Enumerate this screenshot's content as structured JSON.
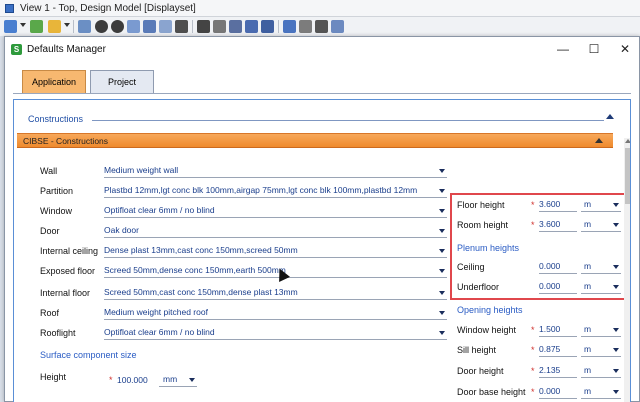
{
  "app": {
    "title": "View 1 - Top, Design Model [Displayset]"
  },
  "dialog": {
    "title": "Defaults Manager",
    "controls": {
      "minimize": "—",
      "maximize": "☐",
      "close": "✕"
    },
    "tabs": [
      {
        "label": "Application",
        "active": true
      },
      {
        "label": "Project",
        "active": false
      }
    ]
  },
  "content": {
    "section_title": "Constructions",
    "group_title": "CIBSE - Constructions",
    "rows": [
      {
        "label": "Wall",
        "value": "Medium weight wall"
      },
      {
        "label": "Partition",
        "value": "Plastbd 12mm,lgt conc blk 100mm,airgap 75mm,lgt conc blk 100mm,plastbd 12mm"
      },
      {
        "label": "Window",
        "value": "Optifloat clear 6mm / no blind"
      },
      {
        "label": "Door",
        "value": "Oak door"
      },
      {
        "label": "Internal ceiling",
        "value": "Dense plast 13mm,cast conc 150mm,screed 50mm"
      },
      {
        "label": "Exposed floor",
        "value": "Screed 50mm,dense conc 150mm,earth 500mm"
      },
      {
        "label": "Internal floor",
        "value": "Screed 50mm,cast conc 150mm,dense plast 13mm"
      },
      {
        "label": "Roof",
        "value": "Medium weight pitched roof"
      },
      {
        "label": "Rooflight",
        "value": "Optifloat clear 6mm / no blind"
      }
    ],
    "surface_heading": "Surface component size",
    "height": {
      "label": "Height",
      "star": "*",
      "value": "100.000",
      "unit": "mm"
    },
    "right": {
      "floor_height": {
        "label": "Floor height",
        "star": "*",
        "value": "3.600",
        "unit": "m"
      },
      "room_height": {
        "label": "Room height",
        "star": "*",
        "value": "3.600",
        "unit": "m"
      },
      "plenum_heading": "Plenum heights",
      "ceiling": {
        "label": "Ceiling",
        "value": "0.000",
        "unit": "m"
      },
      "underfloor": {
        "label": "Underfloor",
        "value": "0.000",
        "unit": "m"
      },
      "opening_heading": "Opening heights",
      "window_height": {
        "label": "Window height",
        "star": "*",
        "value": "1.500",
        "unit": "m"
      },
      "sill_height": {
        "label": "Sill height",
        "star": "*",
        "value": "0.875",
        "unit": "m"
      },
      "door_height": {
        "label": "Door height",
        "star": "*",
        "value": "2.135",
        "unit": "m"
      },
      "door_base_height": {
        "label": "Door base height",
        "star": "*",
        "value": "0.000",
        "unit": "m"
      }
    }
  },
  "colors": {
    "active_tab": "#f7b870",
    "group_bar": "#ef8a2d",
    "link_blue": "#2a5cc4",
    "highlight": "#e0474c"
  }
}
